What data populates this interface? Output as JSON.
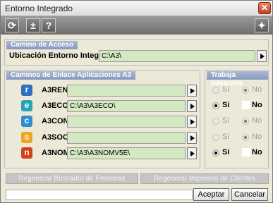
{
  "window": {
    "title": "Entorno Integrado"
  },
  "toolbar": {
    "refresh_icon": "refresh-icon",
    "plusminus_label": "±",
    "help_label": "?",
    "wand_icon": "magic-wand-icon"
  },
  "camino_acceso": {
    "header": "Camino de Acceso",
    "label": "Ubicación Entorno Integrado",
    "value": "C:\\A3\\"
  },
  "caminos_enlace": {
    "header": "Caminos de Enlace Aplicaciones A3",
    "rows": [
      {
        "icon_letter": "r",
        "icon_color": "#2e6fbf",
        "name": "A3REN",
        "path": ""
      },
      {
        "icon_letter": "e",
        "icon_color": "#27a3b6",
        "name": "A3ECO",
        "path": "C:\\A3\\A3ECO\\"
      },
      {
        "icon_letter": "c",
        "icon_color": "#2e8fd0",
        "name": "A3CON",
        "path": ""
      },
      {
        "icon_letter": "s",
        "icon_color": "#f0a521",
        "name": "A3SOC",
        "path": ""
      },
      {
        "icon_letter": "n",
        "icon_color": "#d2411a",
        "name": "A3NOM",
        "path": "C:\\A3\\A3NOMV5E\\"
      }
    ]
  },
  "trabaja_integrada": {
    "header": "Trabaja Integrada",
    "rows": [
      {
        "si": "Si",
        "no": "No",
        "selected": "no",
        "enabled": false
      },
      {
        "si": "Si",
        "no": "No",
        "selected": "si",
        "enabled": true
      },
      {
        "si": "Si",
        "no": "No",
        "selected": "no",
        "enabled": false
      },
      {
        "si": "Si",
        "no": "No",
        "selected": "no",
        "enabled": false
      },
      {
        "si": "Si",
        "no": "No",
        "selected": "si",
        "enabled": true
      }
    ]
  },
  "regen": {
    "buscador": "Regenerar Buscador de Personas",
    "impresos": "Regenerar Impresos de Clientes"
  },
  "footer": {
    "status_value": "",
    "accept_label": "Aceptar",
    "cancel_label": "Cancelar"
  }
}
